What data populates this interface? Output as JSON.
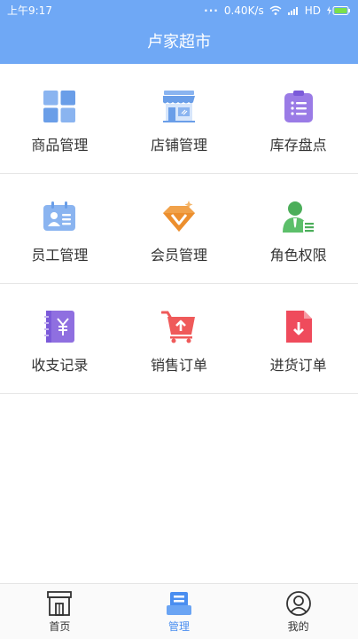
{
  "status_bar": {
    "time": "上午9:17",
    "speed": "0.40K/s",
    "network": "HD"
  },
  "header": {
    "title": "卢家超市"
  },
  "menu": [
    {
      "label": "商品管理",
      "icon": "grid-icon"
    },
    {
      "label": "店铺管理",
      "icon": "store-icon"
    },
    {
      "label": "库存盘点",
      "icon": "clipboard-icon"
    },
    {
      "label": "员工管理",
      "icon": "id-card-icon"
    },
    {
      "label": "会员管理",
      "icon": "diamond-icon"
    },
    {
      "label": "角色权限",
      "icon": "user-role-icon"
    },
    {
      "label": "收支记录",
      "icon": "yuan-notebook-icon"
    },
    {
      "label": "销售订单",
      "icon": "cart-icon"
    },
    {
      "label": "进货订单",
      "icon": "download-doc-icon"
    }
  ],
  "tabs": [
    {
      "label": "首页",
      "icon": "shop-icon",
      "active": false
    },
    {
      "label": "管理",
      "icon": "manage-icon",
      "active": true
    },
    {
      "label": "我的",
      "icon": "profile-icon",
      "active": false
    }
  ],
  "colors": {
    "header": "#6fa8f5",
    "active_tab": "#4a8ef0"
  }
}
